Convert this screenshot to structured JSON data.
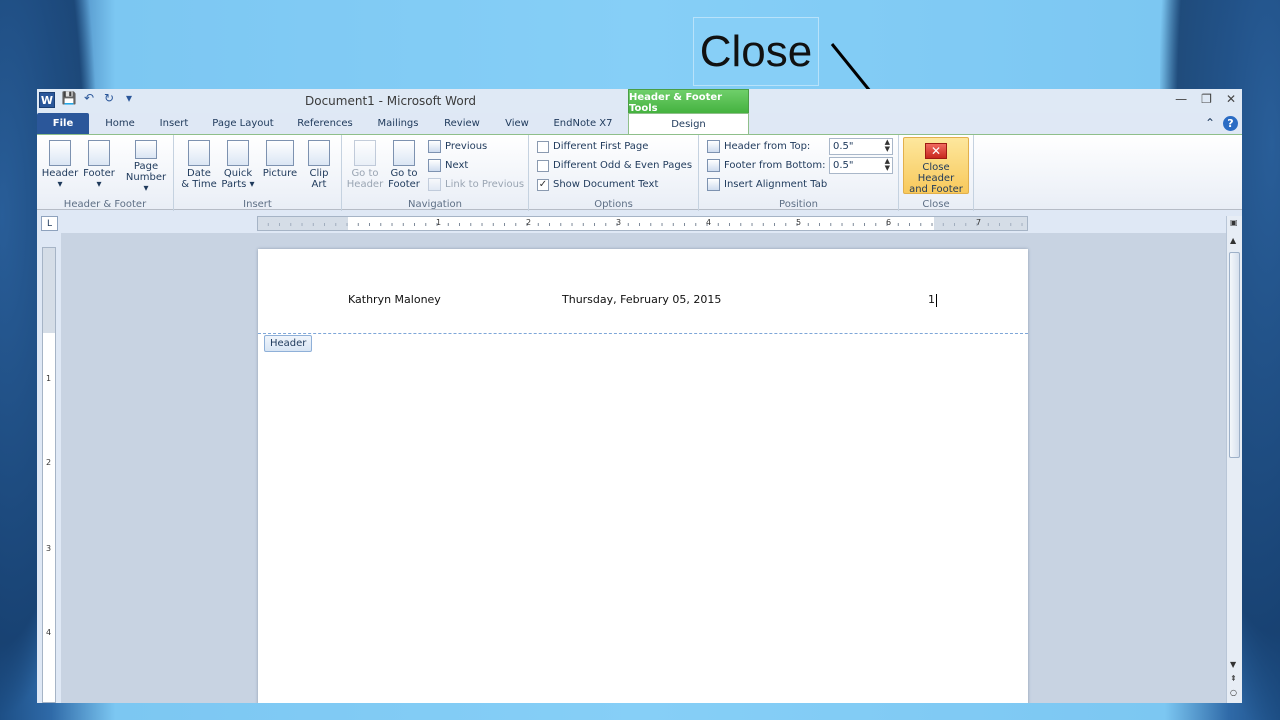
{
  "slide": {
    "callout": "Close"
  },
  "window": {
    "title": "Document1  -  Microsoft Word",
    "app_icon": "W",
    "contextual_tab_group": "Header & Footer Tools"
  },
  "tabs": [
    "File",
    "Home",
    "Insert",
    "Page Layout",
    "References",
    "Mailings",
    "Review",
    "View",
    "EndNote X7",
    "Design"
  ],
  "ribbon": {
    "header_footer": {
      "label": "Header & Footer",
      "header": "Header",
      "footer": "Footer",
      "page_number": [
        "Page",
        "Number"
      ]
    },
    "insert": {
      "label": "Insert",
      "date_time": [
        "Date",
        "& Time"
      ],
      "quick_parts": [
        "Quick",
        "Parts"
      ],
      "picture": "Picture",
      "clip_art": [
        "Clip",
        "Art"
      ]
    },
    "navigation": {
      "label": "Navigation",
      "go_to_header": [
        "Go to",
        "Header"
      ],
      "go_to_footer": [
        "Go to",
        "Footer"
      ],
      "previous": "Previous",
      "next": "Next",
      "link_to_previous": "Link to Previous"
    },
    "options": {
      "label": "Options",
      "different_first_page": "Different First Page",
      "different_odd_even": "Different Odd & Even Pages",
      "show_document_text": "Show Document Text",
      "show_document_text_checked": true
    },
    "position": {
      "label": "Position",
      "header_from_top": "Header from Top:",
      "header_from_top_value": "0.5\"",
      "footer_from_bottom": "Footer from Bottom:",
      "footer_from_bottom_value": "0.5\"",
      "insert_alignment_tab": "Insert Alignment Tab"
    },
    "close": {
      "label": "Close",
      "button": [
        "Close Header",
        "and Footer"
      ]
    }
  },
  "ruler": {
    "numbers": [
      "1",
      "2",
      "3",
      "4",
      "5",
      "6",
      "7"
    ],
    "vnumbers": [
      "1",
      "2",
      "3",
      "4"
    ]
  },
  "document": {
    "header_left": "Kathryn Maloney",
    "header_center": "Thursday, February 05, 2015",
    "header_right": "1",
    "header_tag": "Header"
  }
}
